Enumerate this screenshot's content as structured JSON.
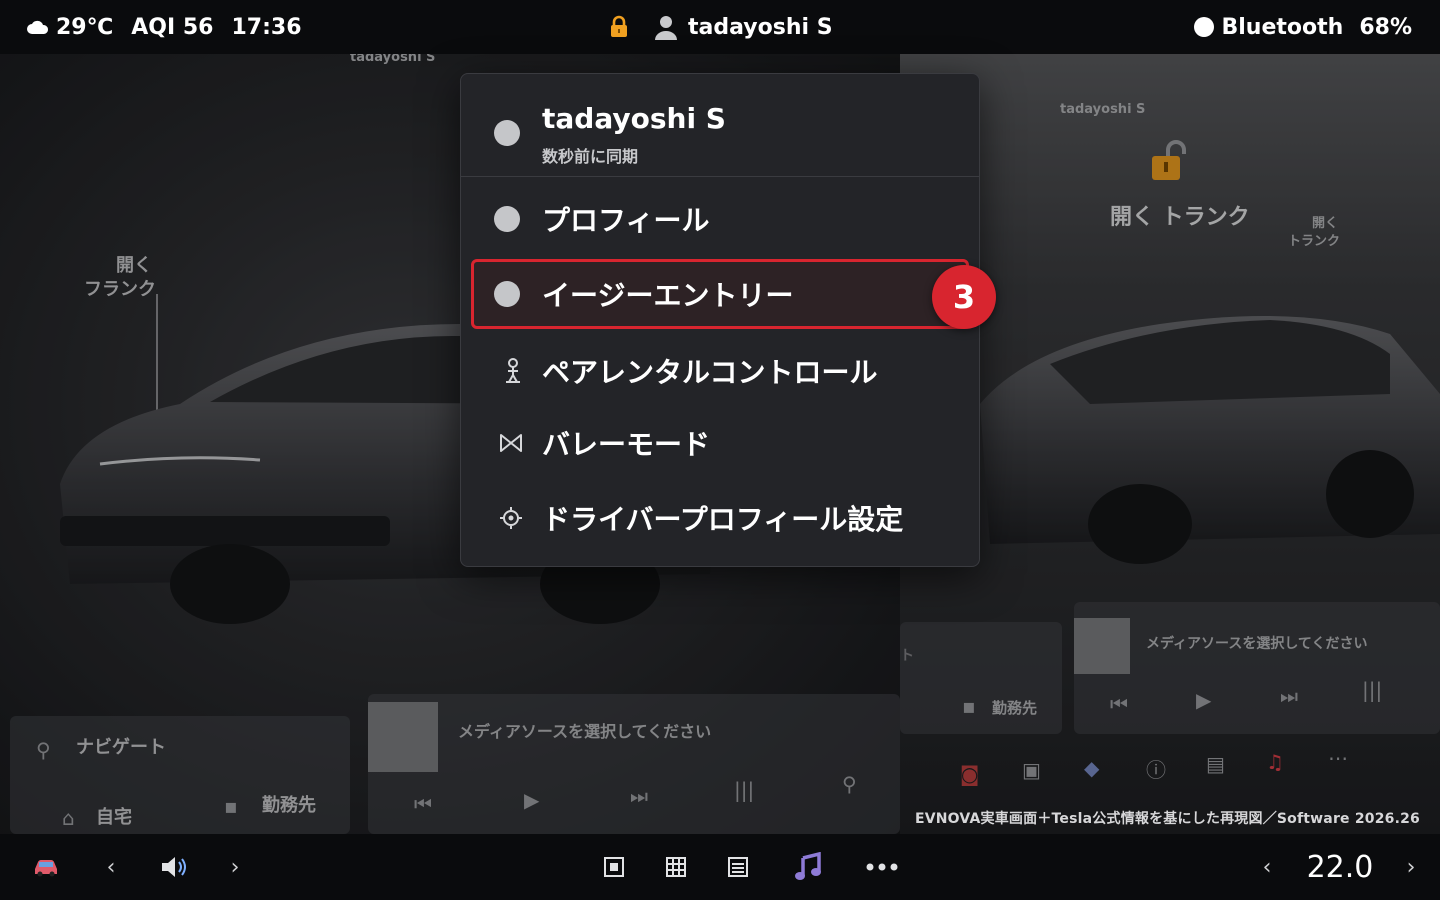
{
  "status_bar": {
    "weather_icon": "cloud-icon",
    "temperature": "29℃",
    "aqi": "AQI 56",
    "time": "17:36",
    "lock_icon": "lock-icon",
    "user_icon": "person-icon",
    "user_name": "tadayoshi S",
    "bluetooth_label": "Bluetooth",
    "battery": "68%"
  },
  "background": {
    "left_panel": {
      "user_label": "tadayoshi S",
      "trunk_label_line1": "開く",
      "trunk_label_line2": "フランク",
      "navigate_label": "ナビゲート",
      "home_label": "自宅",
      "work_label": "勤務先",
      "media_prompt": "メディアソースを選択してください"
    },
    "right_panel": {
      "user_label": "tadayoshi S",
      "open_trunk_label": "開く トランク",
      "small_trunk_line1": "開く",
      "small_trunk_line2": "トランク",
      "nav_partial": "ト",
      "work_label": "勤務先",
      "media_prompt": "メディアソースを選択してください"
    },
    "credit": "EVNOVA実車画面＋Tesla公式情報を基にした再現図／Software 2026.26"
  },
  "menu": {
    "profile_name": "tadayoshi S",
    "sync_status": "数秒前に同期",
    "items": [
      {
        "label": "プロフィール",
        "icon": "circle-icon"
      },
      {
        "label": "イージーエントリー",
        "icon": "circle-icon"
      },
      {
        "label": "ペアレンタルコントロール",
        "icon": "child-figure-icon"
      },
      {
        "label": "バレーモード",
        "icon": "valet-bowtie-icon"
      },
      {
        "label": "ドライバープロフィール設定",
        "icon": "gear-icon"
      }
    ],
    "step_badge": "3",
    "highlight_color": "#d8252f"
  },
  "bottom_bar": {
    "car_icon": "car-icon",
    "volume_icon": "speaker-icon",
    "app_icons": [
      "stop-square-icon",
      "grid-icon",
      "list-icon",
      "music-note-icon",
      "more-dots-icon"
    ],
    "temperature": "22.0"
  }
}
